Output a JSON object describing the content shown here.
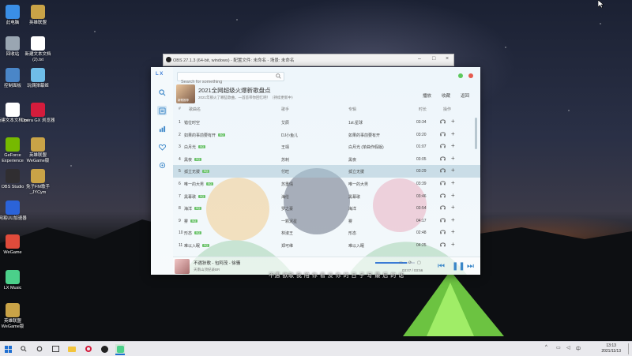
{
  "desktop": {
    "icons": [
      {
        "label": "此电脑",
        "color": "#3a8ee6"
      },
      {
        "label": "英雄联盟",
        "color": "#c9a347"
      },
      {
        "label": "回收站",
        "color": "#9aa6b2"
      },
      {
        "label": "新建文本文档 (2).txt",
        "color": "#ffffff"
      },
      {
        "label": "控制面板",
        "color": "#4a86c8"
      },
      {
        "label": "玩偶弹幕姬",
        "color": "#6fbde8"
      },
      {
        "label": "新建文本文档.txt",
        "color": "#ffffff"
      },
      {
        "label": "Opera GX 浏览器",
        "color": "#d41c3c"
      },
      {
        "label": "GeForce Experience",
        "color": "#76b900"
      },
      {
        "label": "英雄联盟 WeGame版",
        "color": "#c9a347"
      },
      {
        "label": "OBS Studio",
        "color": "#302e31"
      },
      {
        "label": "免子FM歌手_JYCym",
        "color": "#c9a347"
      },
      {
        "label": "网易UU加速器",
        "color": "#2b63d9"
      },
      {
        "label": "WeGame",
        "color": "#e04b3b"
      },
      {
        "label": "LX Music",
        "color": "#4bd08a"
      },
      {
        "label": "英雄联盟 WeGame版",
        "color": "#c9a347"
      }
    ]
  },
  "obs": {
    "title": "OBS 27.1.3 (64-bit, windows) - 配置文件: 未命名 - 场景: 未命名"
  },
  "app": {
    "logo": "L X",
    "search_placeholder": "Search for something",
    "playlist": {
      "title": "2021全网超级火爆新歌盘点",
      "desc": "2021年那火了哪些歌曲，一首首带你回忆吧！（持续更新中）",
      "cover_label": "新歌推荐",
      "actions": [
        "播放",
        "收藏",
        "返回"
      ]
    },
    "columns": {
      "idx": "#",
      "name": "歌曲名",
      "artist": "歌手",
      "album": "专辑",
      "time": "时长",
      "action": "操作"
    },
    "songs": [
      {
        "idx": "1",
        "name": "错位时空",
        "tag": "",
        "artist": "艾辰",
        "album": "1st.星球",
        "time": "03:34"
      },
      {
        "idx": "2",
        "name": "如果的事前要有开",
        "tag": "SQ",
        "artist": "DJ小鱼儿",
        "album": "如果的事前要有开",
        "time": "03:20"
      },
      {
        "idx": "3",
        "name": "白月光",
        "tag": "SQ",
        "artist": "王靖",
        "album": "白月光 (单曲作假版)",
        "time": "01:07"
      },
      {
        "idx": "4",
        "name": "黑夜",
        "tag": "SQ",
        "artist": "苏刺",
        "album": "黑夜",
        "time": "03:05"
      },
      {
        "idx": "5",
        "name": "孤立无援",
        "tag": "SQ",
        "artist": "付旺",
        "album": "孤立无援",
        "time": "03:29"
      },
      {
        "idx": "6",
        "name": "唯一的大男",
        "tag": "SQ",
        "artist": "苏重情",
        "album": "唯一的大男",
        "time": "03:39"
      },
      {
        "idx": "7",
        "name": "黑幕歌",
        "tag": "SQ",
        "artist": "海伦",
        "album": "黑幕歌",
        "time": "03:46"
      },
      {
        "idx": "8",
        "name": "海洋",
        "tag": "SQ",
        "artist": "罗之豪",
        "album": "海洋",
        "time": "03:54"
      },
      {
        "idx": "9",
        "name": "雾",
        "tag": "SQ",
        "artist": "一颗泥星",
        "album": "雾",
        "time": "04:17"
      },
      {
        "idx": "10",
        "name": "形态",
        "tag": "SQ",
        "artist": "林淑王",
        "album": "形态",
        "time": "02:48"
      },
      {
        "idx": "11",
        "name": "难以入眠",
        "tag": "SQ",
        "artist": "郑可维",
        "album": "难以入眠",
        "time": "04:25"
      }
    ],
    "selected_index": 4,
    "player": {
      "title": "不遇狄歌 - 包阿茂 - 徐骚",
      "sub": "天南山顶纪录BR",
      "current": "03:07",
      "total": "03:56",
      "progress": 0.8
    }
  },
  "lyric_overlay": "不遇 欲歌 我 陪 你 看 没 你 的 日 子 写 最 后 的 话",
  "taskbar": {
    "time": "13:13",
    "date": "2021/11/13"
  }
}
